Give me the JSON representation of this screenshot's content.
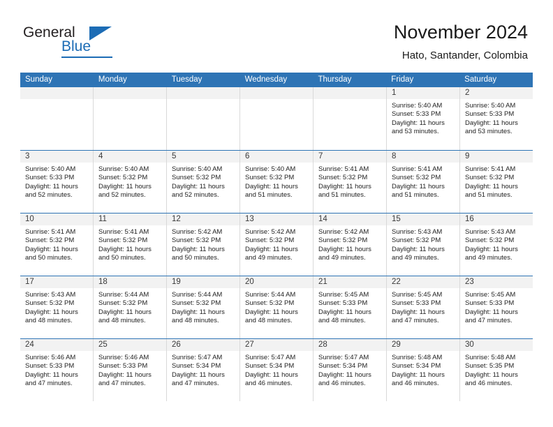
{
  "brand": {
    "name_part1": "General",
    "name_part2": "Blue",
    "accent_color": "#1c6cb5",
    "logo_icon": "triangle-flag-icon"
  },
  "header": {
    "title": "November 2024",
    "subtitle": "Hato, Santander, Colombia"
  },
  "calendar": {
    "header_bg": "#2e74b5",
    "daynum_bg": "#f2f2f2",
    "weekdays": [
      "Sunday",
      "Monday",
      "Tuesday",
      "Wednesday",
      "Thursday",
      "Friday",
      "Saturday"
    ],
    "weeks": [
      [
        {
          "day": "",
          "sunrise": "",
          "sunset": "",
          "daylight": "",
          "empty": true
        },
        {
          "day": "",
          "sunrise": "",
          "sunset": "",
          "daylight": "",
          "empty": true
        },
        {
          "day": "",
          "sunrise": "",
          "sunset": "",
          "daylight": "",
          "empty": true
        },
        {
          "day": "",
          "sunrise": "",
          "sunset": "",
          "daylight": "",
          "empty": true
        },
        {
          "day": "",
          "sunrise": "",
          "sunset": "",
          "daylight": "",
          "empty": true
        },
        {
          "day": "1",
          "sunrise": "Sunrise: 5:40 AM",
          "sunset": "Sunset: 5:33 PM",
          "daylight": "Daylight: 11 hours and 53 minutes.",
          "empty": false
        },
        {
          "day": "2",
          "sunrise": "Sunrise: 5:40 AM",
          "sunset": "Sunset: 5:33 PM",
          "daylight": "Daylight: 11 hours and 53 minutes.",
          "empty": false
        }
      ],
      [
        {
          "day": "3",
          "sunrise": "Sunrise: 5:40 AM",
          "sunset": "Sunset: 5:33 PM",
          "daylight": "Daylight: 11 hours and 52 minutes.",
          "empty": false
        },
        {
          "day": "4",
          "sunrise": "Sunrise: 5:40 AM",
          "sunset": "Sunset: 5:32 PM",
          "daylight": "Daylight: 11 hours and 52 minutes.",
          "empty": false
        },
        {
          "day": "5",
          "sunrise": "Sunrise: 5:40 AM",
          "sunset": "Sunset: 5:32 PM",
          "daylight": "Daylight: 11 hours and 52 minutes.",
          "empty": false
        },
        {
          "day": "6",
          "sunrise": "Sunrise: 5:40 AM",
          "sunset": "Sunset: 5:32 PM",
          "daylight": "Daylight: 11 hours and 51 minutes.",
          "empty": false
        },
        {
          "day": "7",
          "sunrise": "Sunrise: 5:41 AM",
          "sunset": "Sunset: 5:32 PM",
          "daylight": "Daylight: 11 hours and 51 minutes.",
          "empty": false
        },
        {
          "day": "8",
          "sunrise": "Sunrise: 5:41 AM",
          "sunset": "Sunset: 5:32 PM",
          "daylight": "Daylight: 11 hours and 51 minutes.",
          "empty": false
        },
        {
          "day": "9",
          "sunrise": "Sunrise: 5:41 AM",
          "sunset": "Sunset: 5:32 PM",
          "daylight": "Daylight: 11 hours and 51 minutes.",
          "empty": false
        }
      ],
      [
        {
          "day": "10",
          "sunrise": "Sunrise: 5:41 AM",
          "sunset": "Sunset: 5:32 PM",
          "daylight": "Daylight: 11 hours and 50 minutes.",
          "empty": false
        },
        {
          "day": "11",
          "sunrise": "Sunrise: 5:41 AM",
          "sunset": "Sunset: 5:32 PM",
          "daylight": "Daylight: 11 hours and 50 minutes.",
          "empty": false
        },
        {
          "day": "12",
          "sunrise": "Sunrise: 5:42 AM",
          "sunset": "Sunset: 5:32 PM",
          "daylight": "Daylight: 11 hours and 50 minutes.",
          "empty": false
        },
        {
          "day": "13",
          "sunrise": "Sunrise: 5:42 AM",
          "sunset": "Sunset: 5:32 PM",
          "daylight": "Daylight: 11 hours and 49 minutes.",
          "empty": false
        },
        {
          "day": "14",
          "sunrise": "Sunrise: 5:42 AM",
          "sunset": "Sunset: 5:32 PM",
          "daylight": "Daylight: 11 hours and 49 minutes.",
          "empty": false
        },
        {
          "day": "15",
          "sunrise": "Sunrise: 5:43 AM",
          "sunset": "Sunset: 5:32 PM",
          "daylight": "Daylight: 11 hours and 49 minutes.",
          "empty": false
        },
        {
          "day": "16",
          "sunrise": "Sunrise: 5:43 AM",
          "sunset": "Sunset: 5:32 PM",
          "daylight": "Daylight: 11 hours and 49 minutes.",
          "empty": false
        }
      ],
      [
        {
          "day": "17",
          "sunrise": "Sunrise: 5:43 AM",
          "sunset": "Sunset: 5:32 PM",
          "daylight": "Daylight: 11 hours and 48 minutes.",
          "empty": false
        },
        {
          "day": "18",
          "sunrise": "Sunrise: 5:44 AM",
          "sunset": "Sunset: 5:32 PM",
          "daylight": "Daylight: 11 hours and 48 minutes.",
          "empty": false
        },
        {
          "day": "19",
          "sunrise": "Sunrise: 5:44 AM",
          "sunset": "Sunset: 5:32 PM",
          "daylight": "Daylight: 11 hours and 48 minutes.",
          "empty": false
        },
        {
          "day": "20",
          "sunrise": "Sunrise: 5:44 AM",
          "sunset": "Sunset: 5:32 PM",
          "daylight": "Daylight: 11 hours and 48 minutes.",
          "empty": false
        },
        {
          "day": "21",
          "sunrise": "Sunrise: 5:45 AM",
          "sunset": "Sunset: 5:33 PM",
          "daylight": "Daylight: 11 hours and 48 minutes.",
          "empty": false
        },
        {
          "day": "22",
          "sunrise": "Sunrise: 5:45 AM",
          "sunset": "Sunset: 5:33 PM",
          "daylight": "Daylight: 11 hours and 47 minutes.",
          "empty": false
        },
        {
          "day": "23",
          "sunrise": "Sunrise: 5:45 AM",
          "sunset": "Sunset: 5:33 PM",
          "daylight": "Daylight: 11 hours and 47 minutes.",
          "empty": false
        }
      ],
      [
        {
          "day": "24",
          "sunrise": "Sunrise: 5:46 AM",
          "sunset": "Sunset: 5:33 PM",
          "daylight": "Daylight: 11 hours and 47 minutes.",
          "empty": false
        },
        {
          "day": "25",
          "sunrise": "Sunrise: 5:46 AM",
          "sunset": "Sunset: 5:33 PM",
          "daylight": "Daylight: 11 hours and 47 minutes.",
          "empty": false
        },
        {
          "day": "26",
          "sunrise": "Sunrise: 5:47 AM",
          "sunset": "Sunset: 5:34 PM",
          "daylight": "Daylight: 11 hours and 47 minutes.",
          "empty": false
        },
        {
          "day": "27",
          "sunrise": "Sunrise: 5:47 AM",
          "sunset": "Sunset: 5:34 PM",
          "daylight": "Daylight: 11 hours and 46 minutes.",
          "empty": false
        },
        {
          "day": "28",
          "sunrise": "Sunrise: 5:47 AM",
          "sunset": "Sunset: 5:34 PM",
          "daylight": "Daylight: 11 hours and 46 minutes.",
          "empty": false
        },
        {
          "day": "29",
          "sunrise": "Sunrise: 5:48 AM",
          "sunset": "Sunset: 5:34 PM",
          "daylight": "Daylight: 11 hours and 46 minutes.",
          "empty": false
        },
        {
          "day": "30",
          "sunrise": "Sunrise: 5:48 AM",
          "sunset": "Sunset: 5:35 PM",
          "daylight": "Daylight: 11 hours and 46 minutes.",
          "empty": false
        }
      ]
    ]
  }
}
